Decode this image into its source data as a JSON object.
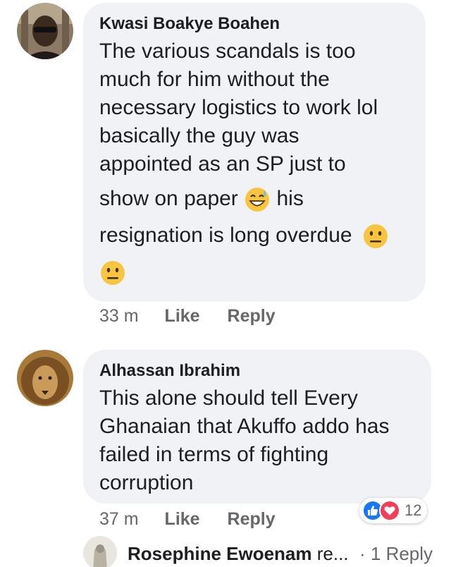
{
  "comments": [
    {
      "author": "Kwasi Boakye Boahen",
      "text_lines": [
        "The various scandals is too",
        "much for him without the",
        "necessary logistics to work lol",
        "basically the guy was",
        "appointed as an SP just to"
      ],
      "line6_before": "show on paper",
      "line6_emoji": "grinning-sweat-emoji",
      "line6_after": "his",
      "line7": "resignation is long overdue",
      "line7_emoji": "neutral-face-emoji",
      "line8_emoji": "neutral-face-emoji",
      "time": "33 m",
      "like_label": "Like",
      "reply_label": "Reply"
    },
    {
      "author": "Alhassan Ibrahim",
      "text_lines": [
        "This alone should tell Every",
        "Ghanaian that Akuffo addo has",
        "failed in terms of fighting",
        "corruption"
      ],
      "time": "37 m",
      "like_label": "Like",
      "reply_label": "Reply",
      "reactions": {
        "icons": [
          "like-reaction-icon",
          "love-reaction-icon"
        ],
        "count": "12"
      }
    }
  ],
  "reply_preview": {
    "name": "Rosephine Ewoenam",
    "truncated": " re...",
    "count_label": "· 1 Reply"
  },
  "colors": {
    "bubble": "#f0f2f5",
    "meta": "#65676b",
    "like_blue": "#1877f2",
    "love_red": "#f33e58"
  }
}
